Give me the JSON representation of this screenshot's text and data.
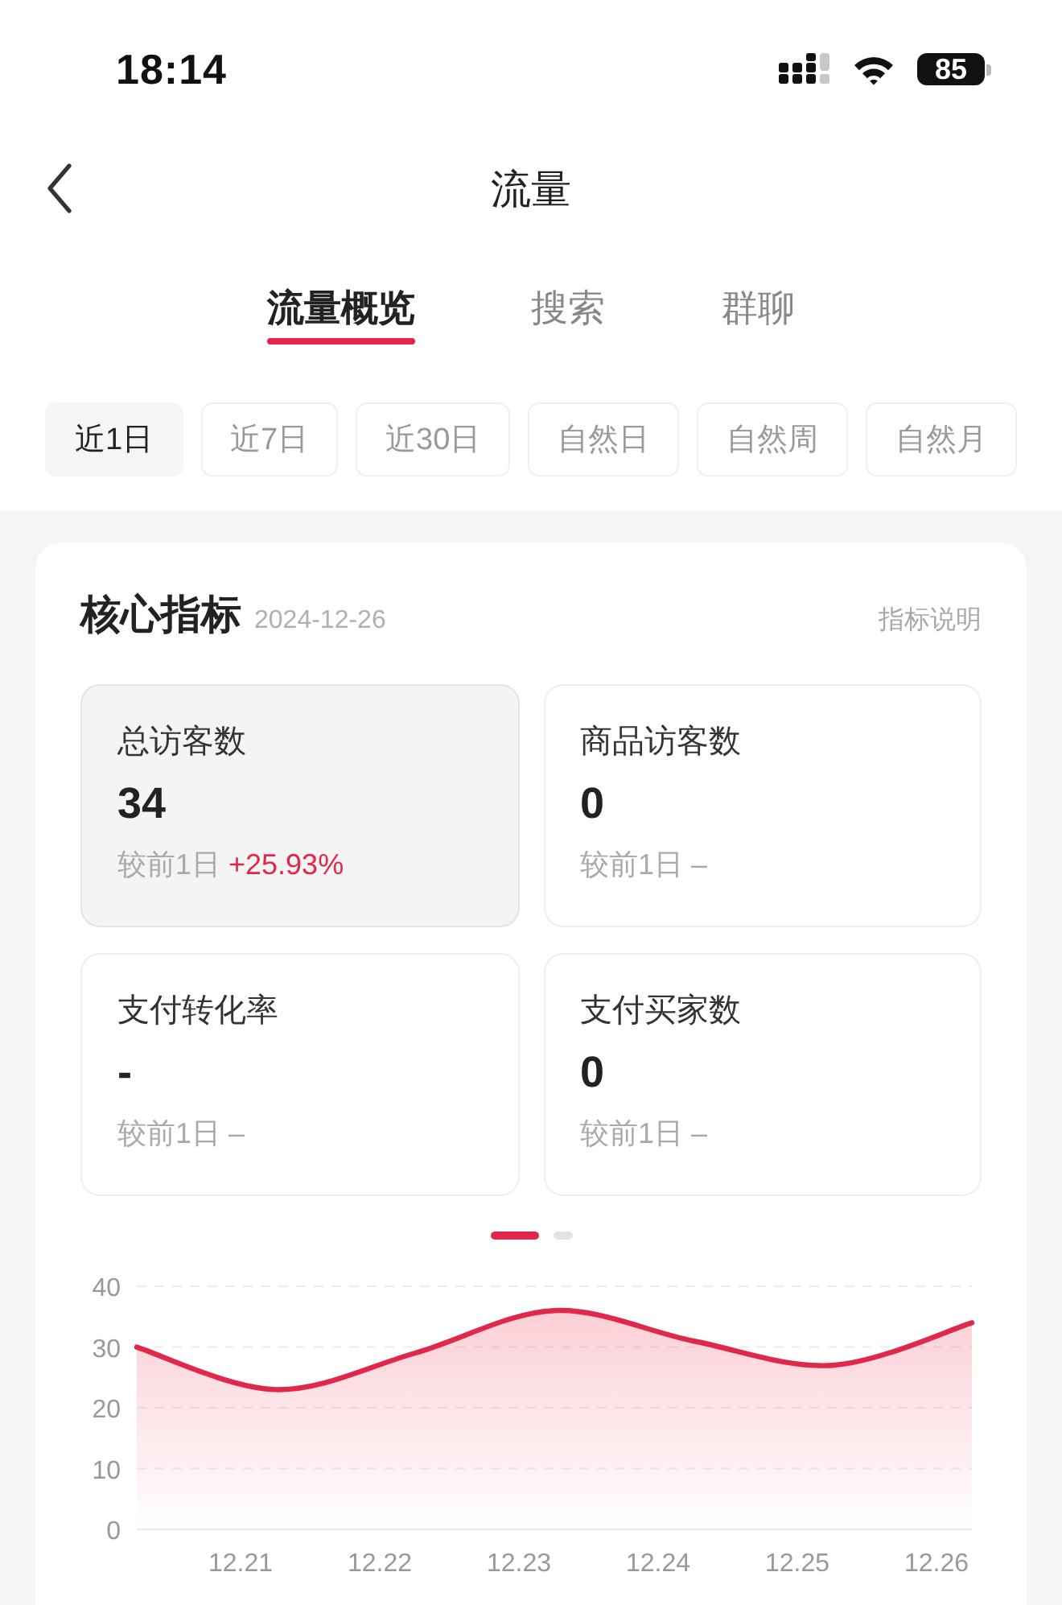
{
  "status_bar": {
    "time": "18:14",
    "battery": "85"
  },
  "nav": {
    "title": "流量"
  },
  "tabs": [
    {
      "label": "流量概览",
      "selected": true
    },
    {
      "label": "搜索",
      "selected": false
    },
    {
      "label": "群聊",
      "selected": false
    }
  ],
  "ranges": [
    {
      "label": "近1日",
      "selected": true
    },
    {
      "label": "近7日",
      "selected": false
    },
    {
      "label": "近30日",
      "selected": false
    },
    {
      "label": "自然日",
      "selected": false
    },
    {
      "label": "自然周",
      "selected": false
    },
    {
      "label": "自然月",
      "selected": false
    }
  ],
  "core_metrics": {
    "title": "核心指标",
    "date": "2024-12-26",
    "help_link": "指标说明",
    "metrics": [
      {
        "label": "总访客数",
        "value": "34",
        "compare_label": "较前1日",
        "change": {
          "text": "+25.93%",
          "color": "#e0294a"
        },
        "selected": true
      },
      {
        "label": "商品访客数",
        "value": "0",
        "compare_label": "较前1日",
        "change": {
          "text": "–",
          "color": "#aaaaaa"
        },
        "selected": false
      },
      {
        "label": "支付转化率",
        "value": "-",
        "compare_label": "较前1日",
        "change": {
          "text": "–",
          "color": "#aaaaaa"
        },
        "selected": false
      },
      {
        "label": "支付买家数",
        "value": "0",
        "compare_label": "较前1日",
        "change": {
          "text": "–",
          "color": "#aaaaaa"
        },
        "selected": false
      }
    ],
    "pager": [
      {
        "selected": true
      },
      {
        "selected": false
      }
    ],
    "chart_data": {
      "type": "area",
      "categories": [
        null,
        "12.21",
        "12.22",
        "12.23",
        "12.24",
        "12.25",
        "12.26"
      ],
      "values": [
        30,
        23,
        29,
        36,
        31,
        27,
        34
      ],
      "ylim": [
        0,
        40
      ],
      "yticks": [
        0,
        10,
        20,
        30,
        40
      ],
      "grid": true
    }
  }
}
